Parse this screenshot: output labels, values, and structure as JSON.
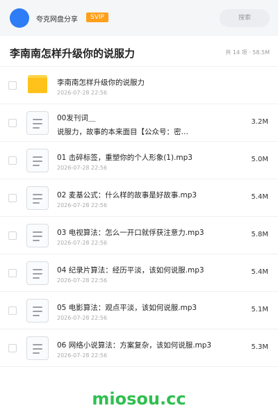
{
  "header": {
    "app_name": "夸克网盘分享",
    "badge": "SVIP",
    "search_placeholder": "搜索"
  },
  "folder": {
    "title": "李南南怎样升级你的说服力",
    "summary": "共 14 项 · 58.5M"
  },
  "items": [
    {
      "type": "folder",
      "name": "李南南怎样升级你的说服力",
      "date": "2026-07-28 22:56",
      "size": ""
    },
    {
      "type": "file",
      "name": "00发刊词＿",
      "name2": "说服力，故事的本来面目【公众号：密…",
      "date": "2026-07-28 22:56",
      "size": "3.2M"
    },
    {
      "type": "file",
      "name": "01 击碎标签，重塑你的个人形象(1).mp3",
      "date": "2026-07-28 22:56",
      "size": "5.0M"
    },
    {
      "type": "file",
      "name": "02 麦基公式：什么样的故事是好故事.mp3",
      "date": "2026-07-28 22:56",
      "size": "5.4M"
    },
    {
      "type": "file",
      "name": "03 电视算法：怎么一开口就俘获注意力.mp3",
      "date": "2026-07-28 22:56",
      "size": "5.8M"
    },
    {
      "type": "file",
      "name": "04 纪录片算法：经历平淡，该如何说服.mp3",
      "date": "2026-07-28 22:56",
      "size": "5.4M"
    },
    {
      "type": "file",
      "name": "05 电影算法：观点平淡，该如何说服.mp3",
      "date": "2026-07-28 22:56",
      "size": "5.1M"
    },
    {
      "type": "file",
      "name": "06 网络小说算法：方案复杂，该如何说服.mp3",
      "date": "2026-07-28 22:56",
      "size": "5.3M"
    }
  ],
  "watermark": "miosou.cc",
  "colors": {
    "brand": "#2e7cf6",
    "svip": "#ff9f1a",
    "folder": "#ffc21a",
    "watermark": "#2fbf4f"
  }
}
